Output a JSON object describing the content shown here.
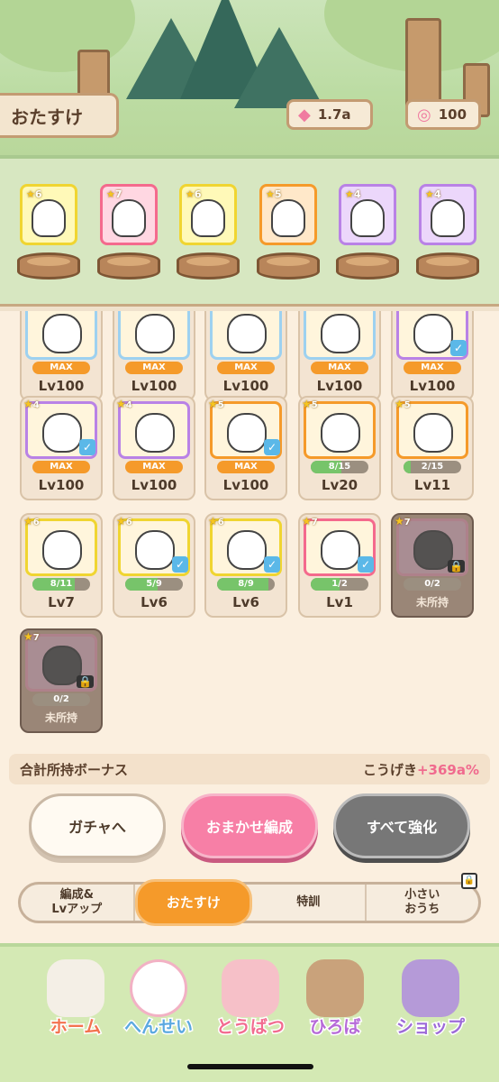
{
  "header": {
    "title": "おたすけ",
    "resources": [
      {
        "icon": "candy-icon",
        "value": "1.7a"
      },
      {
        "icon": "lollipop-icon",
        "value": "100"
      }
    ]
  },
  "slots": [
    {
      "rarity": "6",
      "frame": "#f0d531",
      "bg": "#fff9b8"
    },
    {
      "rarity": "7",
      "frame": "#f46a8d",
      "bg": "#ffd7e2"
    },
    {
      "rarity": "6",
      "frame": "#f0d531",
      "bg": "#fff9b8"
    },
    {
      "rarity": "5",
      "frame": "#f59a2a",
      "bg": "#ffe8c9"
    },
    {
      "rarity": "4",
      "frame": "#b982e6",
      "bg": "#ecd7fb"
    },
    {
      "rarity": "4",
      "frame": "#b982e6",
      "bg": "#ecd7fb"
    }
  ],
  "cards": [
    {
      "rarity": "",
      "progress": "MAX",
      "fraction": 1,
      "level": "Lv100",
      "checked": false,
      "frame": "#9dd1f0",
      "locked": false
    },
    {
      "rarity": "",
      "progress": "MAX",
      "fraction": 1,
      "level": "Lv100",
      "checked": false,
      "frame": "#9dd1f0",
      "locked": false
    },
    {
      "rarity": "",
      "progress": "MAX",
      "fraction": 1,
      "level": "Lv100",
      "checked": false,
      "frame": "#9dd1f0",
      "locked": false
    },
    {
      "rarity": "",
      "progress": "MAX",
      "fraction": 1,
      "level": "Lv100",
      "checked": false,
      "frame": "#9dd1f0",
      "locked": false
    },
    {
      "rarity": "",
      "progress": "MAX",
      "fraction": 1,
      "level": "Lv100",
      "checked": true,
      "frame": "#b982e6",
      "locked": false
    },
    {
      "rarity": "4",
      "progress": "MAX",
      "fraction": 1,
      "level": "Lv100",
      "checked": true,
      "frame": "#b982e6",
      "locked": false
    },
    {
      "rarity": "4",
      "progress": "MAX",
      "fraction": 1,
      "level": "Lv100",
      "checked": false,
      "frame": "#b982e6",
      "locked": false
    },
    {
      "rarity": "5",
      "progress": "MAX",
      "fraction": 1,
      "level": "Lv100",
      "checked": true,
      "frame": "#f59a2a",
      "locked": false
    },
    {
      "rarity": "5",
      "progress": "8/15",
      "fraction": 0.53,
      "level": "Lv20",
      "checked": false,
      "frame": "#f59a2a",
      "locked": false
    },
    {
      "rarity": "5",
      "progress": "2/15",
      "fraction": 0.13,
      "level": "Lv11",
      "checked": false,
      "frame": "#f59a2a",
      "locked": false
    },
    {
      "rarity": "6",
      "progress": "8/11",
      "fraction": 0.73,
      "level": "Lv7",
      "checked": false,
      "frame": "#f0d531",
      "locked": false
    },
    {
      "rarity": "6",
      "progress": "5/9",
      "fraction": 0.56,
      "level": "Lv6",
      "checked": true,
      "frame": "#f0d531",
      "locked": false
    },
    {
      "rarity": "6",
      "progress": "8/9",
      "fraction": 0.89,
      "level": "Lv6",
      "checked": true,
      "frame": "#f0d531",
      "locked": false
    },
    {
      "rarity": "7",
      "progress": "1/2",
      "fraction": 0.5,
      "level": "Lv1",
      "checked": true,
      "frame": "#f46a8d",
      "locked": false
    },
    {
      "rarity": "7",
      "progress": "0/2",
      "fraction": 0,
      "level": "未所持",
      "checked": false,
      "frame": "#c97a8d",
      "locked": true
    },
    {
      "rarity": "7",
      "progress": "0/2",
      "fraction": 0,
      "level": "未所持",
      "checked": false,
      "frame": "#c97a8d",
      "locked": true
    }
  ],
  "bonus": {
    "label": "合計所持ボーナス",
    "stat": "こうげき",
    "value": "+369a%"
  },
  "actions": {
    "gacha": "ガチャへ",
    "omakase": "おまかせ編成",
    "upgrade_all": "すべて強化"
  },
  "tabs": [
    {
      "label": "編成&\nLvアップ"
    },
    {
      "label": "おたすけ",
      "active": true
    },
    {
      "label": "特訓"
    },
    {
      "label": "小さい\nおうち"
    }
  ],
  "nav": [
    {
      "label": "ホーム",
      "color": "#f3734f"
    },
    {
      "label": "へんせい",
      "color": "#5aa8e0",
      "active": true
    },
    {
      "label": "とうばつ",
      "color": "#f26b8f"
    },
    {
      "label": "ひろば",
      "color": "#b66ad8"
    },
    {
      "label": "ショップ",
      "color": "#9d6ad8"
    }
  ]
}
